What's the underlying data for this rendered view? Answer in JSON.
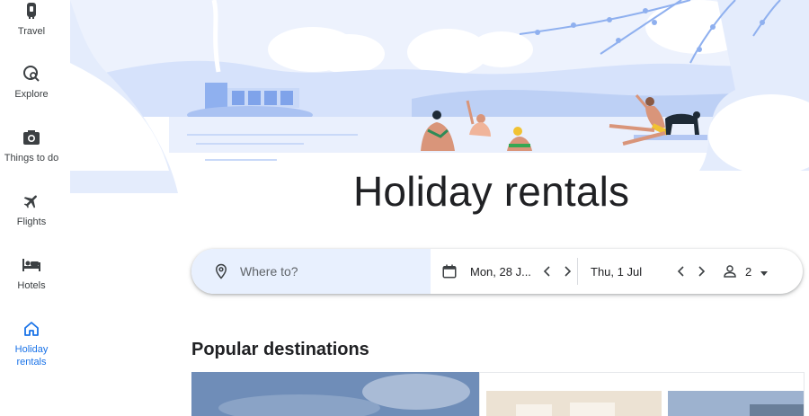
{
  "sidebar": {
    "items": [
      {
        "label": "Travel",
        "icon": "travel-icon",
        "active": false
      },
      {
        "label": "Explore",
        "icon": "explore-icon",
        "active": false
      },
      {
        "label": "Things to do",
        "icon": "things-to-do-icon",
        "active": false
      },
      {
        "label": "Flights",
        "icon": "flights-icon",
        "active": false
      },
      {
        "label": "Hotels",
        "icon": "hotels-icon",
        "active": false
      },
      {
        "label": "Holiday\nrentals",
        "icon": "home-icon",
        "active": true
      }
    ]
  },
  "hero": {
    "title": "Holiday rentals"
  },
  "search": {
    "where_placeholder": "Where to?",
    "checkin": "Mon, 28 J...",
    "checkout": "Thu, 1 Jul",
    "guests": "2"
  },
  "popular": {
    "title": "Popular destinations"
  },
  "colors": {
    "accent": "#1a73e8",
    "where_bg": "#e8f0fe",
    "illustration_blue": "#c6d7f7"
  }
}
